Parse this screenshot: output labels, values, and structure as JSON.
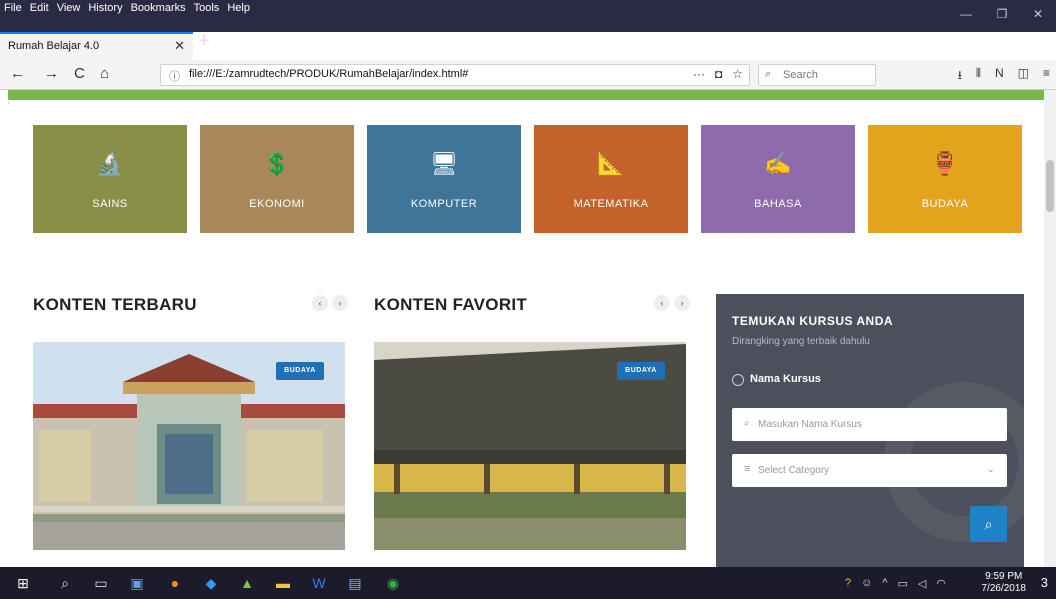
{
  "menu": [
    "File",
    "Edit",
    "View",
    "History",
    "Bookmarks",
    "Tools",
    "Help"
  ],
  "window_controls": {
    "minimize": "—",
    "restore": "❐",
    "close": "✕"
  },
  "tab": {
    "title": "Rumah Belajar 4.0",
    "close": "✕",
    "new": "+"
  },
  "nav": {
    "back": "←",
    "forward": "→",
    "reload": "C",
    "home": "⌂"
  },
  "url": {
    "info_icon": "ⓘ",
    "text": "file:///E:/zamrudtech/PRODUK/RumahBelajar/index.html#",
    "more": "···",
    "pocket": "◘",
    "star": "☆"
  },
  "search": {
    "icon": "⌕",
    "placeholder": "Search"
  },
  "toolbar_icons": [
    "download-icon",
    "library-icon",
    "reader-icon",
    "sidebar-icon",
    "menu-icon"
  ],
  "toolbar_glyphs": [
    "⭳",
    "⫴",
    "N",
    "◫",
    "≡"
  ],
  "categories": [
    {
      "label": "SAINS",
      "icon": "science-icon",
      "glyph": "🔬",
      "color": "#8a8f48"
    },
    {
      "label": "EKONOMI",
      "icon": "money-hand-icon",
      "glyph": "💲",
      "color": "#a8885b"
    },
    {
      "label": "KOMPUTER",
      "icon": "computer-icon",
      "glyph": "🖥",
      "color": "#3f7598"
    },
    {
      "label": "MATEMATIKA",
      "icon": "geometry-icon",
      "glyph": "📐",
      "color": "#c3622b"
    },
    {
      "label": "BAHASA",
      "icon": "language-icon",
      "glyph": "✍",
      "color": "#8d6bad"
    },
    {
      "label": "BUDAYA",
      "icon": "culture-icon",
      "glyph": "🏺",
      "color": "#e3a31c"
    }
  ],
  "latest": {
    "title": "KONTEN TERBARU",
    "prev": "‹",
    "next": "›",
    "badge": "BUDAYA"
  },
  "favorite": {
    "title": "KONTEN FAVORIT",
    "prev": "‹",
    "next": "›",
    "badge": "BUDAYA"
  },
  "finder": {
    "title": "TEMUKAN KURSUS ANDA",
    "subtitle": "Dirangking yang terbaik dahulu",
    "radio_label": "Nama Kursus",
    "name_placeholder": "Masukan Nama Kursus",
    "category_placeholder": "Select Category",
    "search_icon": "search-icon"
  },
  "clock": {
    "time": "9:59 PM",
    "date": "7/26/2018"
  },
  "notification_count": "3"
}
